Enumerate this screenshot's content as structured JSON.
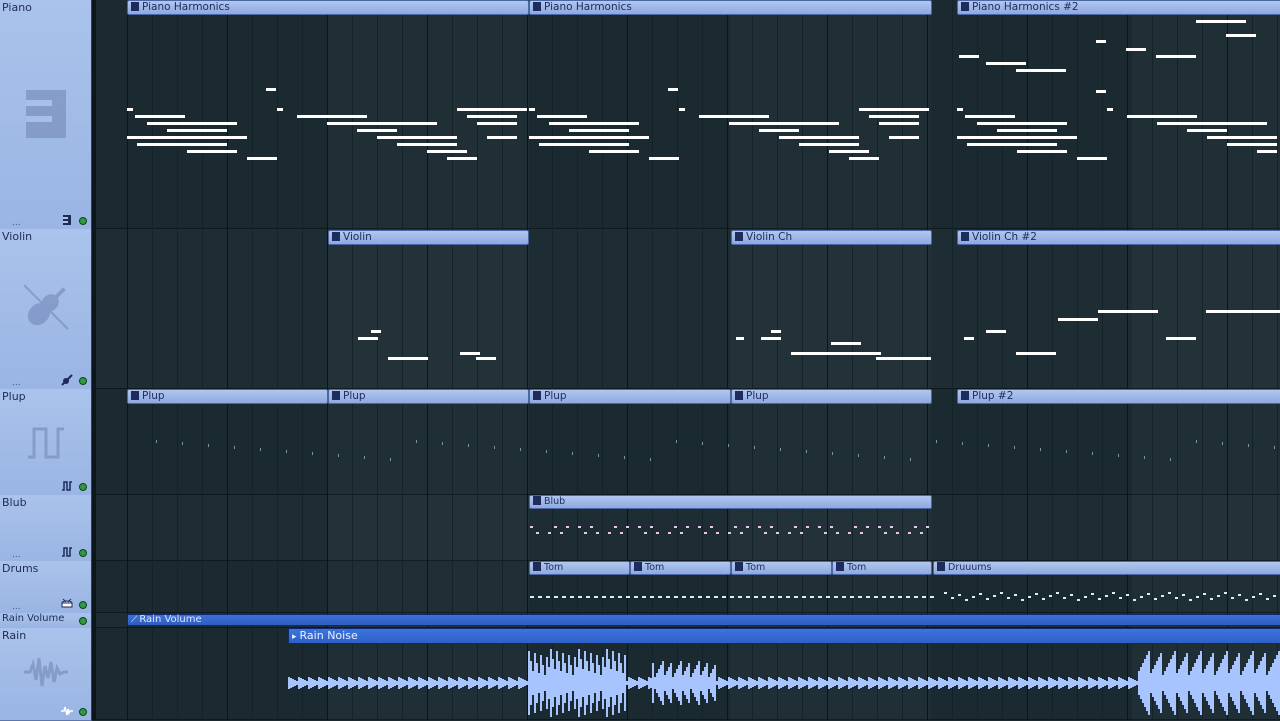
{
  "tracks": [
    {
      "name": "Piano",
      "icon": "piano-roll-icon"
    },
    {
      "name": "Violin",
      "icon": "violin-icon"
    },
    {
      "name": "Plup",
      "icon": "square-wave-icon"
    },
    {
      "name": "Blub",
      "icon": "square-wave-icon"
    },
    {
      "name": "Drums",
      "icon": "drum-icon"
    },
    {
      "name": "Rain Volume",
      "icon": "automation-icon"
    },
    {
      "name": "Rain",
      "icon": "audio-clip-icon"
    }
  ],
  "ellipsis": "...",
  "clips": {
    "piano": [
      "Piano Harmonics",
      "Piano Harmonics",
      "Piano Harmonics #2"
    ],
    "violin": [
      "Violin",
      "Violin Ch",
      "Violin Ch #2"
    ],
    "plup": [
      "Plup",
      "Plup",
      "Plup",
      "Plup",
      "Plup #2"
    ],
    "blub": [
      "Blub"
    ],
    "drums": [
      "Tom",
      "Tom",
      "Tom",
      "Tom",
      "Druuums"
    ],
    "rain_volume": "Rain Volume",
    "rain": "Rain Noise"
  },
  "colors": {
    "clip_bar": "#9ab4e8",
    "note": "#ffffff",
    "blub_note": "#e7c4f2",
    "waveform": "#a7c4ff",
    "automation": "#2f5dc2"
  }
}
